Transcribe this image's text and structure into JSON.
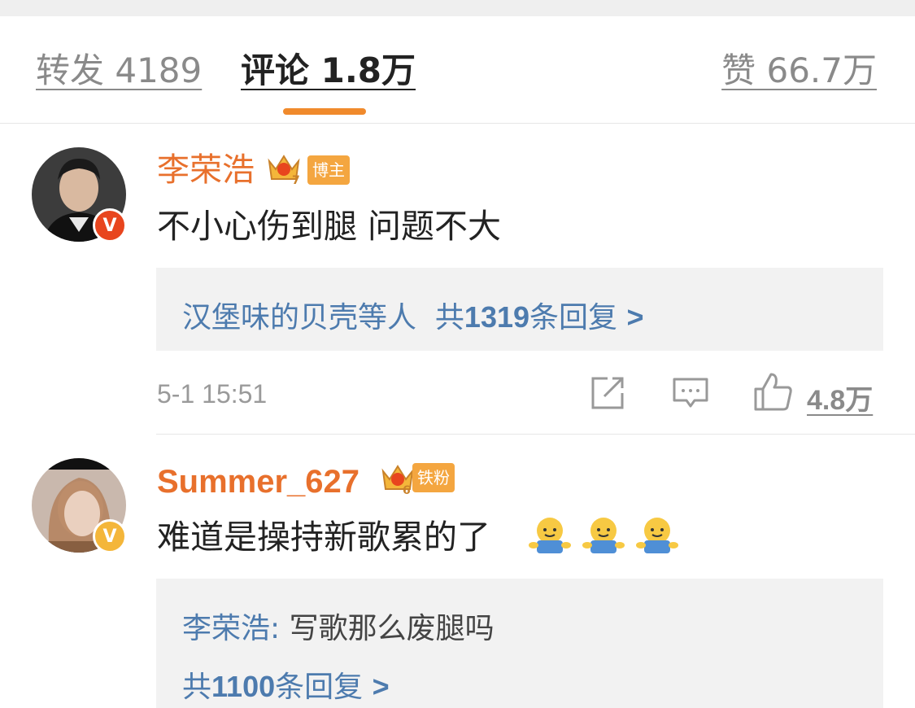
{
  "tabs": {
    "repost": "转发 4189",
    "comments": "评论 1.8万",
    "likes": "赞 66.7万"
  },
  "comments": [
    {
      "username": "李荣浩",
      "crown_level": "7",
      "tag": "博主",
      "text": "不小心伤到腿 问题不大",
      "replies_preview": {
        "names": "汉堡味的贝壳等人",
        "prefix": "共",
        "count": "1319",
        "suffix": "条回复",
        "chevron": ">"
      },
      "time": "5-1 15:51",
      "likes": "4.8万",
      "badge": "V",
      "colors": {
        "badge": "#e8451e"
      }
    },
    {
      "username": "Summer_627",
      "crown_level": "6",
      "tag": "铁粉",
      "text": "难道是操持新歌累的了",
      "emoji_count": 3,
      "replies_preview": {
        "reply_author": "李荣浩",
        "reply_sep": ":",
        "reply_text": " 写歌那么废腿吗",
        "prefix": "共",
        "count": "1100",
        "suffix": "条回复",
        "chevron": ">"
      },
      "badge": "V",
      "colors": {
        "badge": "#f4b63a"
      }
    }
  ],
  "icons": [
    "repost-icon",
    "comment-icon",
    "like-icon",
    "crown-icon",
    "hug-emoji-icon"
  ],
  "colors": {
    "accent": "#f08a2c",
    "username": "#e8702c",
    "link": "#4d7bae"
  }
}
